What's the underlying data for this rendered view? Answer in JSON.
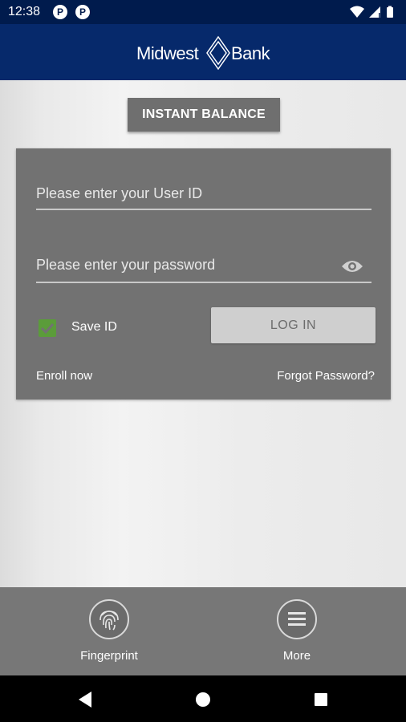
{
  "status_bar": {
    "time": "12:38",
    "app_icon_glyph": "P"
  },
  "header": {
    "logo_word1": "Midwest",
    "logo_word2": "Bank"
  },
  "instant_balance": {
    "label": "INSTANT BALANCE"
  },
  "login_form": {
    "userid_placeholder": "Please enter your User ID",
    "password_placeholder": "Please enter your password",
    "save_id_label": "Save ID",
    "save_id_checked": true,
    "login_label": "LOG IN",
    "enroll_label": "Enroll now",
    "forgot_label": "Forgot Password?"
  },
  "bottom_bar": {
    "fingerprint_label": "Fingerprint",
    "more_label": "More"
  },
  "colors": {
    "header_bg": "#06296b",
    "status_bg": "#001b4d",
    "panel_bg": "#727272",
    "checkbox_green": "#5b9c3a"
  }
}
